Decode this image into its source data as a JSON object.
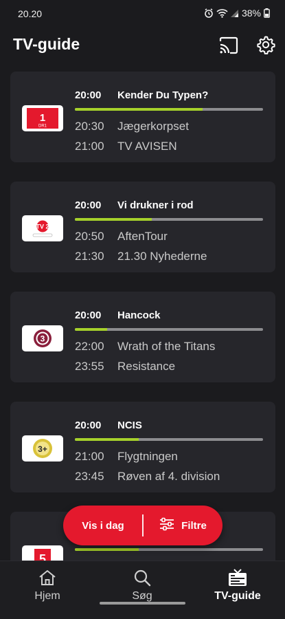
{
  "status": {
    "time": "20.20",
    "battery": "38%"
  },
  "header": {
    "title": "TV-guide"
  },
  "channels": [
    {
      "logo_text": "1",
      "logo_sub": "DR1",
      "now_time": "20:00",
      "now_title": "Kender Du Typen?",
      "progress": 0.68,
      "next": [
        {
          "time": "20:30",
          "title": "Jægerkorpset"
        },
        {
          "time": "21:00",
          "title": "TV AVISEN"
        }
      ]
    },
    {
      "logo_text": "2",
      "logo_sub": "TV 2",
      "now_time": "20:00",
      "now_title": "Vi drukner i rod",
      "progress": 0.41,
      "next": [
        {
          "time": "20:50",
          "title": "AftenTour"
        },
        {
          "time": "21:30",
          "title": "21.30 Nyhederne"
        }
      ]
    },
    {
      "logo_text": "3",
      "logo_sub": "",
      "now_time": "20:00",
      "now_title": "Hancock",
      "progress": 0.17,
      "next": [
        {
          "time": "22:00",
          "title": "Wrath of the Titans"
        },
        {
          "time": "23:55",
          "title": "Resistance"
        }
      ]
    },
    {
      "logo_text": "3+",
      "logo_sub": "",
      "now_time": "20:00",
      "now_title": "NCIS",
      "progress": 0.34,
      "next": [
        {
          "time": "21:00",
          "title": "Flygtningen"
        },
        {
          "time": "23:45",
          "title": "Røven af 4. division"
        }
      ]
    },
    {
      "logo_text": "5",
      "logo_sub": "",
      "now_time": "",
      "now_title": "",
      "progress": 0.34,
      "next": [
        {
          "time": "",
          "title": ""
        },
        {
          "time": "",
          "title": ""
        }
      ]
    }
  ],
  "fab": {
    "today_label": "Vis i dag",
    "filter_label": "Filtre"
  },
  "nav": {
    "home": "Hjem",
    "search": "Søg",
    "tvguide": "TV-guide"
  },
  "colors": {
    "accent_red": "#e4192d",
    "progress_green": "#a6d12b",
    "card_bg": "#26262b"
  },
  "icons": [
    "alarm-icon",
    "wifi-icon",
    "signal-icon",
    "battery-icon",
    "cast-icon",
    "gear-icon",
    "sliders-icon",
    "home-icon",
    "search-icon",
    "tv-icon"
  ]
}
